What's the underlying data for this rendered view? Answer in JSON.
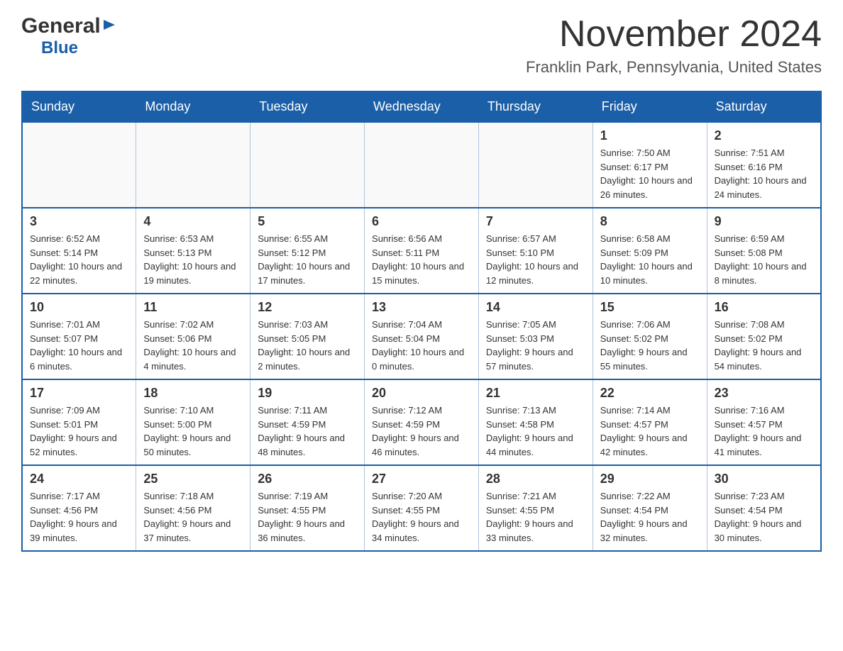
{
  "header": {
    "logo_general": "General",
    "logo_blue": "Blue",
    "title": "November 2024",
    "subtitle": "Franklin Park, Pennsylvania, United States"
  },
  "calendar": {
    "days_of_week": [
      "Sunday",
      "Monday",
      "Tuesday",
      "Wednesday",
      "Thursday",
      "Friday",
      "Saturday"
    ],
    "weeks": [
      {
        "days": [
          {
            "num": "",
            "info": "",
            "empty": true
          },
          {
            "num": "",
            "info": "",
            "empty": true
          },
          {
            "num": "",
            "info": "",
            "empty": true
          },
          {
            "num": "",
            "info": "",
            "empty": true
          },
          {
            "num": "",
            "info": "",
            "empty": true
          },
          {
            "num": "1",
            "info": "Sunrise: 7:50 AM\nSunset: 6:17 PM\nDaylight: 10 hours and 26 minutes.",
            "empty": false
          },
          {
            "num": "2",
            "info": "Sunrise: 7:51 AM\nSunset: 6:16 PM\nDaylight: 10 hours and 24 minutes.",
            "empty": false
          }
        ]
      },
      {
        "days": [
          {
            "num": "3",
            "info": "Sunrise: 6:52 AM\nSunset: 5:14 PM\nDaylight: 10 hours and 22 minutes.",
            "empty": false
          },
          {
            "num": "4",
            "info": "Sunrise: 6:53 AM\nSunset: 5:13 PM\nDaylight: 10 hours and 19 minutes.",
            "empty": false
          },
          {
            "num": "5",
            "info": "Sunrise: 6:55 AM\nSunset: 5:12 PM\nDaylight: 10 hours and 17 minutes.",
            "empty": false
          },
          {
            "num": "6",
            "info": "Sunrise: 6:56 AM\nSunset: 5:11 PM\nDaylight: 10 hours and 15 minutes.",
            "empty": false
          },
          {
            "num": "7",
            "info": "Sunrise: 6:57 AM\nSunset: 5:10 PM\nDaylight: 10 hours and 12 minutes.",
            "empty": false
          },
          {
            "num": "8",
            "info": "Sunrise: 6:58 AM\nSunset: 5:09 PM\nDaylight: 10 hours and 10 minutes.",
            "empty": false
          },
          {
            "num": "9",
            "info": "Sunrise: 6:59 AM\nSunset: 5:08 PM\nDaylight: 10 hours and 8 minutes.",
            "empty": false
          }
        ]
      },
      {
        "days": [
          {
            "num": "10",
            "info": "Sunrise: 7:01 AM\nSunset: 5:07 PM\nDaylight: 10 hours and 6 minutes.",
            "empty": false
          },
          {
            "num": "11",
            "info": "Sunrise: 7:02 AM\nSunset: 5:06 PM\nDaylight: 10 hours and 4 minutes.",
            "empty": false
          },
          {
            "num": "12",
            "info": "Sunrise: 7:03 AM\nSunset: 5:05 PM\nDaylight: 10 hours and 2 minutes.",
            "empty": false
          },
          {
            "num": "13",
            "info": "Sunrise: 7:04 AM\nSunset: 5:04 PM\nDaylight: 10 hours and 0 minutes.",
            "empty": false
          },
          {
            "num": "14",
            "info": "Sunrise: 7:05 AM\nSunset: 5:03 PM\nDaylight: 9 hours and 57 minutes.",
            "empty": false
          },
          {
            "num": "15",
            "info": "Sunrise: 7:06 AM\nSunset: 5:02 PM\nDaylight: 9 hours and 55 minutes.",
            "empty": false
          },
          {
            "num": "16",
            "info": "Sunrise: 7:08 AM\nSunset: 5:02 PM\nDaylight: 9 hours and 54 minutes.",
            "empty": false
          }
        ]
      },
      {
        "days": [
          {
            "num": "17",
            "info": "Sunrise: 7:09 AM\nSunset: 5:01 PM\nDaylight: 9 hours and 52 minutes.",
            "empty": false
          },
          {
            "num": "18",
            "info": "Sunrise: 7:10 AM\nSunset: 5:00 PM\nDaylight: 9 hours and 50 minutes.",
            "empty": false
          },
          {
            "num": "19",
            "info": "Sunrise: 7:11 AM\nSunset: 4:59 PM\nDaylight: 9 hours and 48 minutes.",
            "empty": false
          },
          {
            "num": "20",
            "info": "Sunrise: 7:12 AM\nSunset: 4:59 PM\nDaylight: 9 hours and 46 minutes.",
            "empty": false
          },
          {
            "num": "21",
            "info": "Sunrise: 7:13 AM\nSunset: 4:58 PM\nDaylight: 9 hours and 44 minutes.",
            "empty": false
          },
          {
            "num": "22",
            "info": "Sunrise: 7:14 AM\nSunset: 4:57 PM\nDaylight: 9 hours and 42 minutes.",
            "empty": false
          },
          {
            "num": "23",
            "info": "Sunrise: 7:16 AM\nSunset: 4:57 PM\nDaylight: 9 hours and 41 minutes.",
            "empty": false
          }
        ]
      },
      {
        "days": [
          {
            "num": "24",
            "info": "Sunrise: 7:17 AM\nSunset: 4:56 PM\nDaylight: 9 hours and 39 minutes.",
            "empty": false
          },
          {
            "num": "25",
            "info": "Sunrise: 7:18 AM\nSunset: 4:56 PM\nDaylight: 9 hours and 37 minutes.",
            "empty": false
          },
          {
            "num": "26",
            "info": "Sunrise: 7:19 AM\nSunset: 4:55 PM\nDaylight: 9 hours and 36 minutes.",
            "empty": false
          },
          {
            "num": "27",
            "info": "Sunrise: 7:20 AM\nSunset: 4:55 PM\nDaylight: 9 hours and 34 minutes.",
            "empty": false
          },
          {
            "num": "28",
            "info": "Sunrise: 7:21 AM\nSunset: 4:55 PM\nDaylight: 9 hours and 33 minutes.",
            "empty": false
          },
          {
            "num": "29",
            "info": "Sunrise: 7:22 AM\nSunset: 4:54 PM\nDaylight: 9 hours and 32 minutes.",
            "empty": false
          },
          {
            "num": "30",
            "info": "Sunrise: 7:23 AM\nSunset: 4:54 PM\nDaylight: 9 hours and 30 minutes.",
            "empty": false
          }
        ]
      }
    ]
  }
}
